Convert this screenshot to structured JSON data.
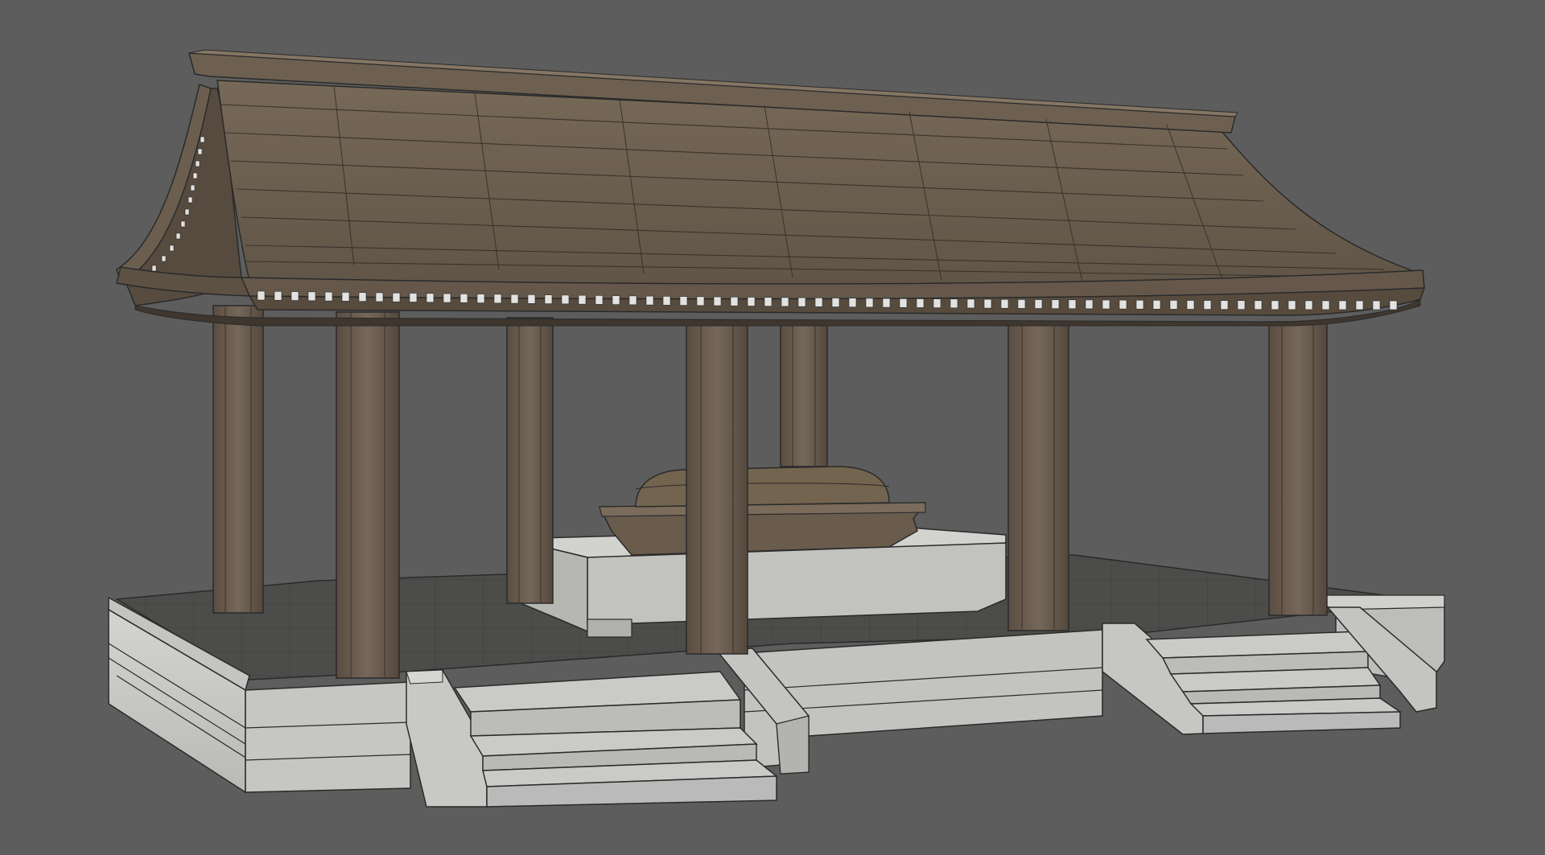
{
  "scene": {
    "subject": "pavilion-render",
    "background_color": "#5d5d5d",
    "colors": {
      "roof_stone": "#6e6152",
      "roof_dark": "#4a4036",
      "roof_edge": "#2e2822",
      "pillar_stone": "#6a5b4c",
      "pillar_dark": "#4b4036",
      "base_stone": "#c9c9c6",
      "base_shadow": "#a8a8a5",
      "floor_tile": "#4a4a48",
      "wire": "#2a2a2a",
      "dentil_light": "#e2e2e0"
    }
  }
}
